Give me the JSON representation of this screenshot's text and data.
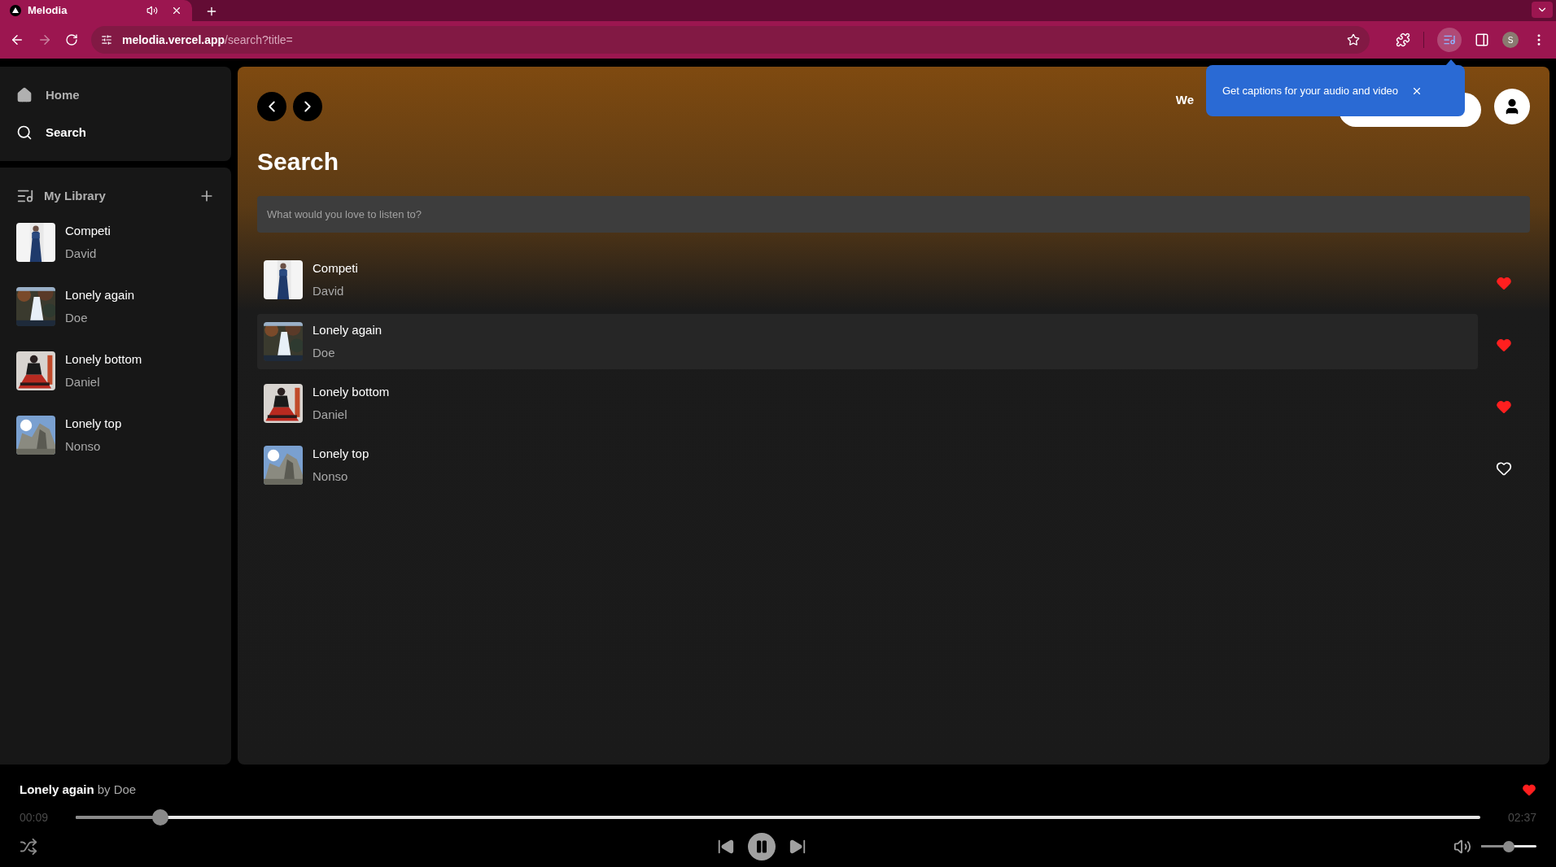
{
  "browser": {
    "tab_title": "Melodia",
    "url_host": "melodia.vercel.app",
    "url_path": "/search?title=",
    "profile_initial": "S"
  },
  "captions_popup": {
    "text": "Get captions for your audio and video"
  },
  "sidebar": {
    "nav": [
      {
        "kind": "home",
        "label": "Home",
        "selected": false
      },
      {
        "kind": "search",
        "label": "Search",
        "selected": true
      }
    ],
    "library_title": "My Library",
    "library": [
      {
        "title": "Competi",
        "artist": "David"
      },
      {
        "title": "Lonely again",
        "artist": "Doe"
      },
      {
        "title": "Lonely bottom",
        "artist": "Daniel"
      },
      {
        "title": "Lonely top",
        "artist": "Nonso"
      }
    ]
  },
  "header": {
    "welcome": "We"
  },
  "page_title": "Search",
  "search": {
    "placeholder": "What would you love to listen to?"
  },
  "results": [
    {
      "title": "Competi",
      "artist": "David",
      "liked": true,
      "selected": false
    },
    {
      "title": "Lonely again",
      "artist": "Doe",
      "liked": true,
      "selected": true
    },
    {
      "title": "Lonely bottom",
      "artist": "Daniel",
      "liked": true,
      "selected": false
    },
    {
      "title": "Lonely top",
      "artist": "Nonso",
      "liked": false,
      "selected": false
    }
  ],
  "player": {
    "title": "Lonely again",
    "by": "by Doe",
    "liked": true,
    "elapsed": "00:09",
    "duration": "02:37",
    "level": 0.06,
    "shuffle": false,
    "playing": true,
    "volume": {
      "level": 0.5
    }
  }
}
